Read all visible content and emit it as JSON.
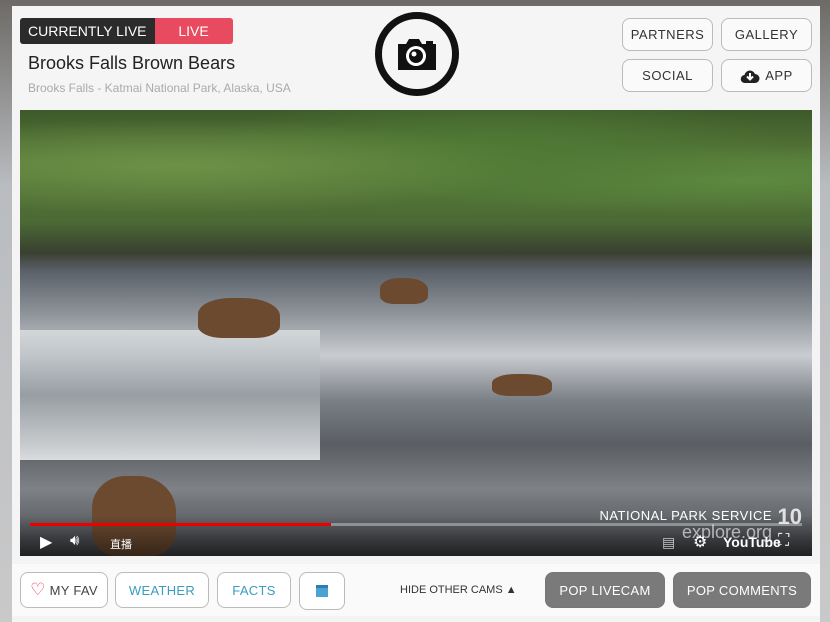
{
  "header": {
    "currently_live": "CURRENTLY LIVE",
    "live_badge": "LIVE",
    "title": "Brooks Falls Brown Bears",
    "subtitle": "Brooks Falls - Katmai National Park, Alaska, USA",
    "buttons": {
      "partners": "PARTNERS",
      "gallery": "GALLERY",
      "social": "SOCIAL",
      "app": "APP"
    }
  },
  "video": {
    "watermark_org": "NATIONAL PARK SERVICE",
    "watermark_site": "explore.org",
    "watermark_badge": "10",
    "live_label": "直播",
    "youtube_label": "YouTube",
    "progress_percent": 39
  },
  "bottom": {
    "my_fav": "MY FAV",
    "weather": "WEATHER",
    "facts": "FACTS",
    "hide_other_cams": "HIDE OTHER CAMS",
    "pop_livecam": "POP LIVECAM",
    "pop_comments": "POP COMMENTS"
  },
  "colors": {
    "live": "#e84a5f",
    "accent": "#3a9cc0",
    "progress": "#ee0000"
  }
}
